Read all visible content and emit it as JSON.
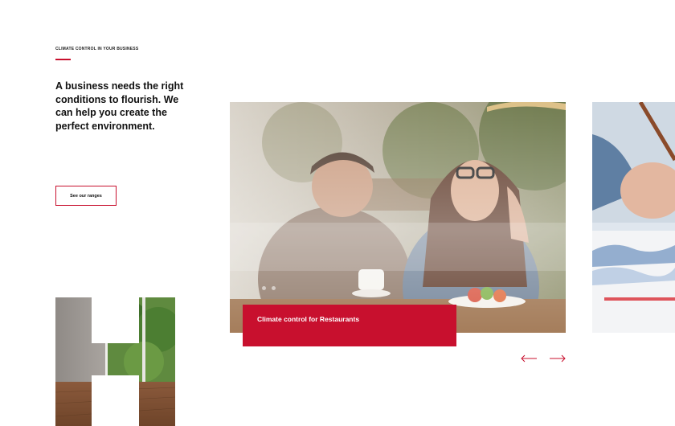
{
  "theme": {
    "accent": "#c8102e"
  },
  "intro": {
    "eyebrow": "CLIMATE CONTROL IN YOUR BUSINESS",
    "headline": "A business needs the right conditions to flourish. We can help you create the perfect environment.",
    "cta_label": "See our ranges"
  },
  "carousel": {
    "active_caption": "Climate control for Restaurants",
    "prev_icon": "arrow-left-icon",
    "next_icon": "arrow-right-icon"
  },
  "images": {
    "h_logo": "interior-room-with-window-in-h-shape",
    "main_slide": "couple-in-restaurant-behind-window",
    "next_slide": "hand-writing-on-paper"
  }
}
